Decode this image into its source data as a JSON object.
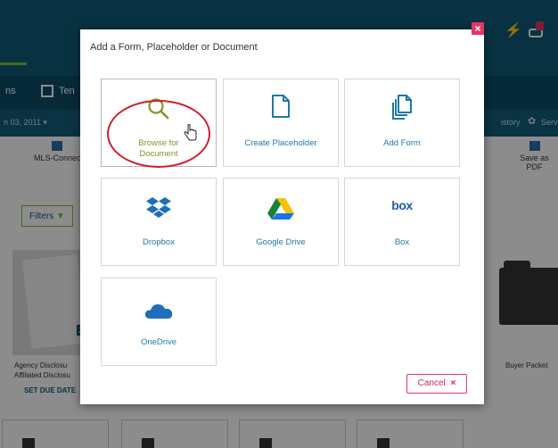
{
  "background": {
    "subnav_tab_left": "ns",
    "subnav_tab_right": "Ten",
    "date_text": "n 03, 2011 ▾",
    "history_label": "istory",
    "serv_label": "Serv",
    "toolbar_left_label": "MLS-Connec",
    "toolbar_right_label": "Save as PDF",
    "filters_label": "Filters",
    "doc_card_line1": "Agency Disclosu",
    "doc_card_line2": "Affiliated Disclosu",
    "set_due_label": "SET DUE DATE",
    "buyer_packet_label": "Buyer Packet",
    "thumb_corner_text": "21"
  },
  "modal": {
    "title": "Add a Form, Placeholder or Document",
    "close_glyph": "×",
    "tiles": [
      {
        "label": "Browse for Document",
        "icon": "search-icon"
      },
      {
        "label": "Create Placeholder",
        "icon": "file-icon"
      },
      {
        "label": "Add Form",
        "icon": "copy-icon"
      },
      {
        "label": "Dropbox",
        "icon": "dropbox-icon"
      },
      {
        "label": "Google Drive",
        "icon": "google-drive-icon"
      },
      {
        "label": "Box",
        "icon": "box-icon",
        "logo_text": "box"
      },
      {
        "label": "OneDrive",
        "icon": "onedrive-icon"
      }
    ],
    "cancel_label": "Cancel",
    "cancel_glyph": "×"
  },
  "colors": {
    "accent_blue": "#1f78a8",
    "accent_green": "#7a9a2d",
    "header_blue": "#0f5b78",
    "cancel_pink": "#e8336b",
    "highlight_red": "#d01f2e"
  }
}
